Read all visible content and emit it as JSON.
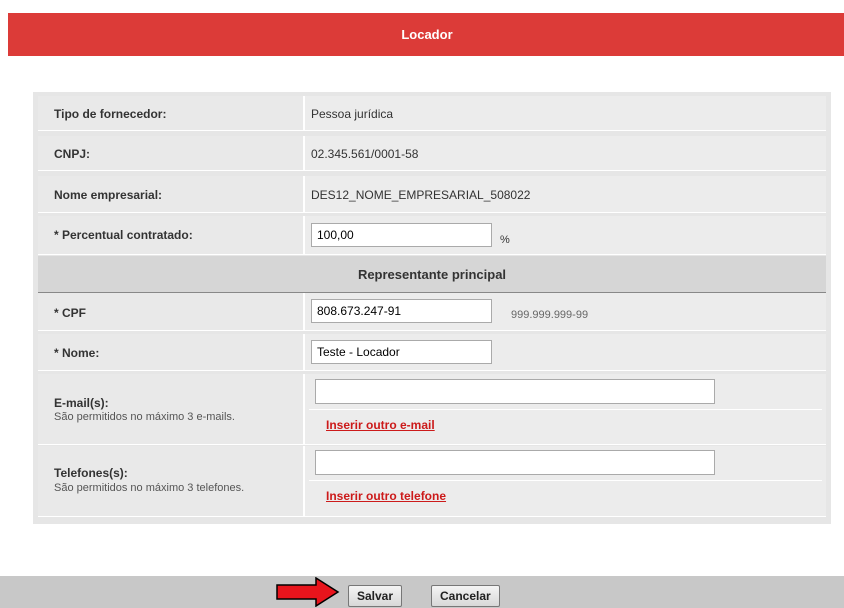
{
  "header": {
    "title": "Locador"
  },
  "form": {
    "supplier_type": {
      "label": "Tipo de fornecedor:",
      "value": "Pessoa jurídica"
    },
    "cnpj": {
      "label": "CNPJ:",
      "value": "02.345.561/0001-58"
    },
    "company_name": {
      "label": "Nome empresarial:",
      "value": "DES12_NOME_EMPRESARIAL_508022"
    },
    "percent": {
      "label": "* Percentual contratado:",
      "value": "100,00",
      "unit": "%"
    }
  },
  "representative": {
    "section_title": "Representante principal",
    "cpf": {
      "label": "* CPF",
      "value": "808.673.247-91",
      "hint": "999.999.999-99"
    },
    "name": {
      "label": "* Nome:",
      "value": "Teste - Locador"
    },
    "emails": {
      "label": "E-mail(s):",
      "sublabel": "São permitidos no máximo 3 e-mails.",
      "value": "",
      "add_link": "Inserir outro e-mail"
    },
    "phones": {
      "label": "Telefones(s):",
      "sublabel": "São permitidos no máximo 3 telefones.",
      "value": "",
      "add_link": "Inserir outro telefone"
    }
  },
  "footer": {
    "save_label": "Salvar",
    "cancel_label": "Cancelar",
    "arrow_color": "#e8141c"
  },
  "colors": {
    "header": "#dc3b38",
    "link": "#cc1a1a"
  }
}
